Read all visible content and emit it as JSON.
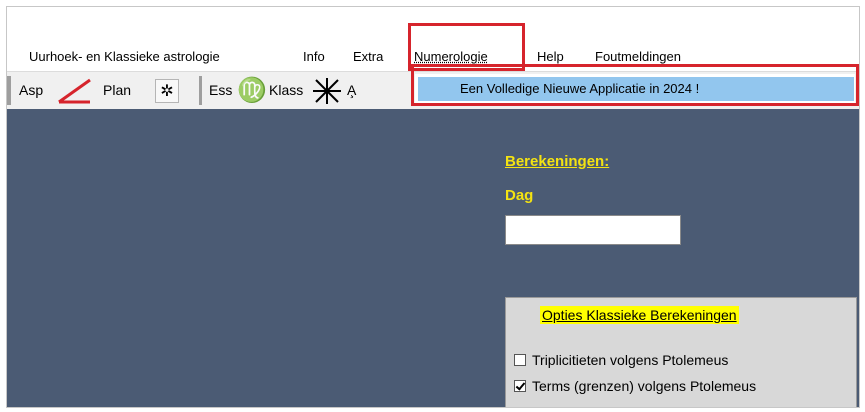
{
  "menu": {
    "items": [
      "Uurhoek- en Klassieke astrologie",
      "Info",
      "Extra",
      "Numerologie",
      "Help",
      "Foutmeldingen"
    ],
    "open_index": 3
  },
  "dropdown": {
    "item": "Een Volledige Nieuwe Applicatie in 2024 !"
  },
  "toolbar": {
    "asp": "Asp",
    "plan": "Plan",
    "ess": "Ess",
    "klass": "Klass",
    "ap": "A̧"
  },
  "main": {
    "title": "Berekeningen:",
    "dag_label": "Dag",
    "dag_value": ""
  },
  "options": {
    "title": "Opties Klassieke Berekeningen",
    "rows": [
      {
        "label": "Triplicitieten volgens Ptolemeus",
        "checked": false
      },
      {
        "label": "Terms (grenzen) volgens Ptolemeus",
        "checked": true
      }
    ]
  },
  "colors": {
    "background": "#4b5b74",
    "accent_yellow": "#f4e312",
    "highlight_red": "#d6242c",
    "menu_selected": "#92c6ee"
  }
}
